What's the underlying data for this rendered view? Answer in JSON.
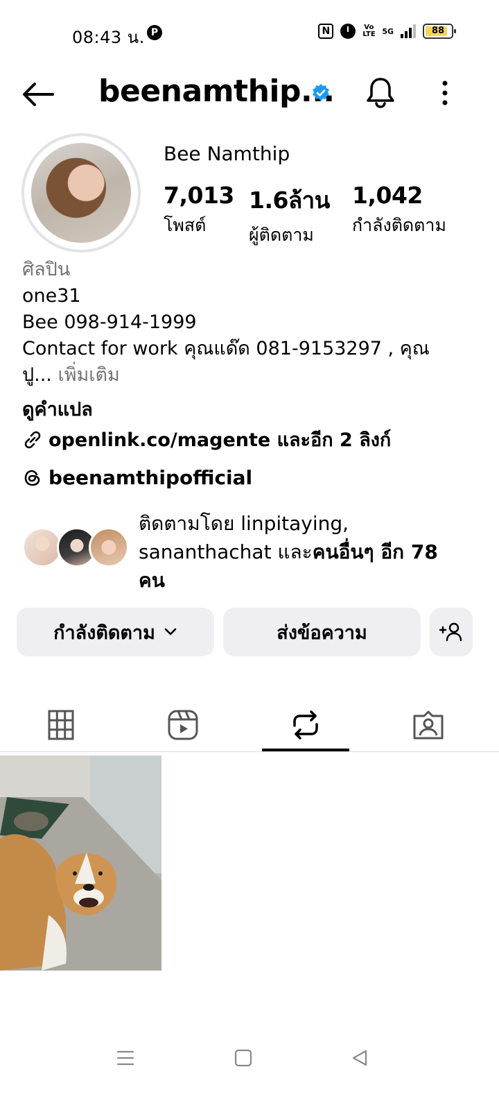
{
  "status_bar": {
    "time": "08:43 น.",
    "pin_glyph": "P",
    "nfc_glyph": "N",
    "volte": "Vo LTE",
    "network": "5G",
    "battery": "88",
    "battery_level": 0.88
  },
  "header": {
    "username": "beenamthip...",
    "verified_icon": "verified-badge-icon",
    "accent": "#1d9bf0"
  },
  "profile": {
    "display_name": "Bee Namthip",
    "stats": [
      {
        "value": "7,013",
        "label": "โพสต์"
      },
      {
        "value": "1.6ล้าน",
        "label": "ผู้ติดตาม"
      },
      {
        "value": "1,042",
        "label": "กำลังติดตาม"
      }
    ],
    "bio": {
      "category": "ศิลปิน",
      "lines": [
        "one31",
        "Bee 098-914-1999",
        "Contact for work คุณแด๊ด 081-9153297 , คุณ"
      ],
      "last_line": "ปู...",
      "more": " เพิ่มเติม"
    },
    "translate": "ดูคำแปล",
    "link": "openlink.co/magente และอีก 2 ลิงก์",
    "threads": "beenamthipofficial",
    "mutual": {
      "prefix": "ติดตามโดย ",
      "names": "linpitaying,",
      "line2_name": "sananthachat ",
      "and": "และ",
      "others": "คนอื่นๆ อีก 78",
      "last": "คน"
    }
  },
  "actions": {
    "following": "กำลังติดตาม",
    "message": "ส่งข้อความ",
    "add_user_icon": "+person"
  },
  "tabs": [
    "grid-icon",
    "reels-icon",
    "reposts-icon",
    "tagged-icon"
  ],
  "active_tab": 2
}
